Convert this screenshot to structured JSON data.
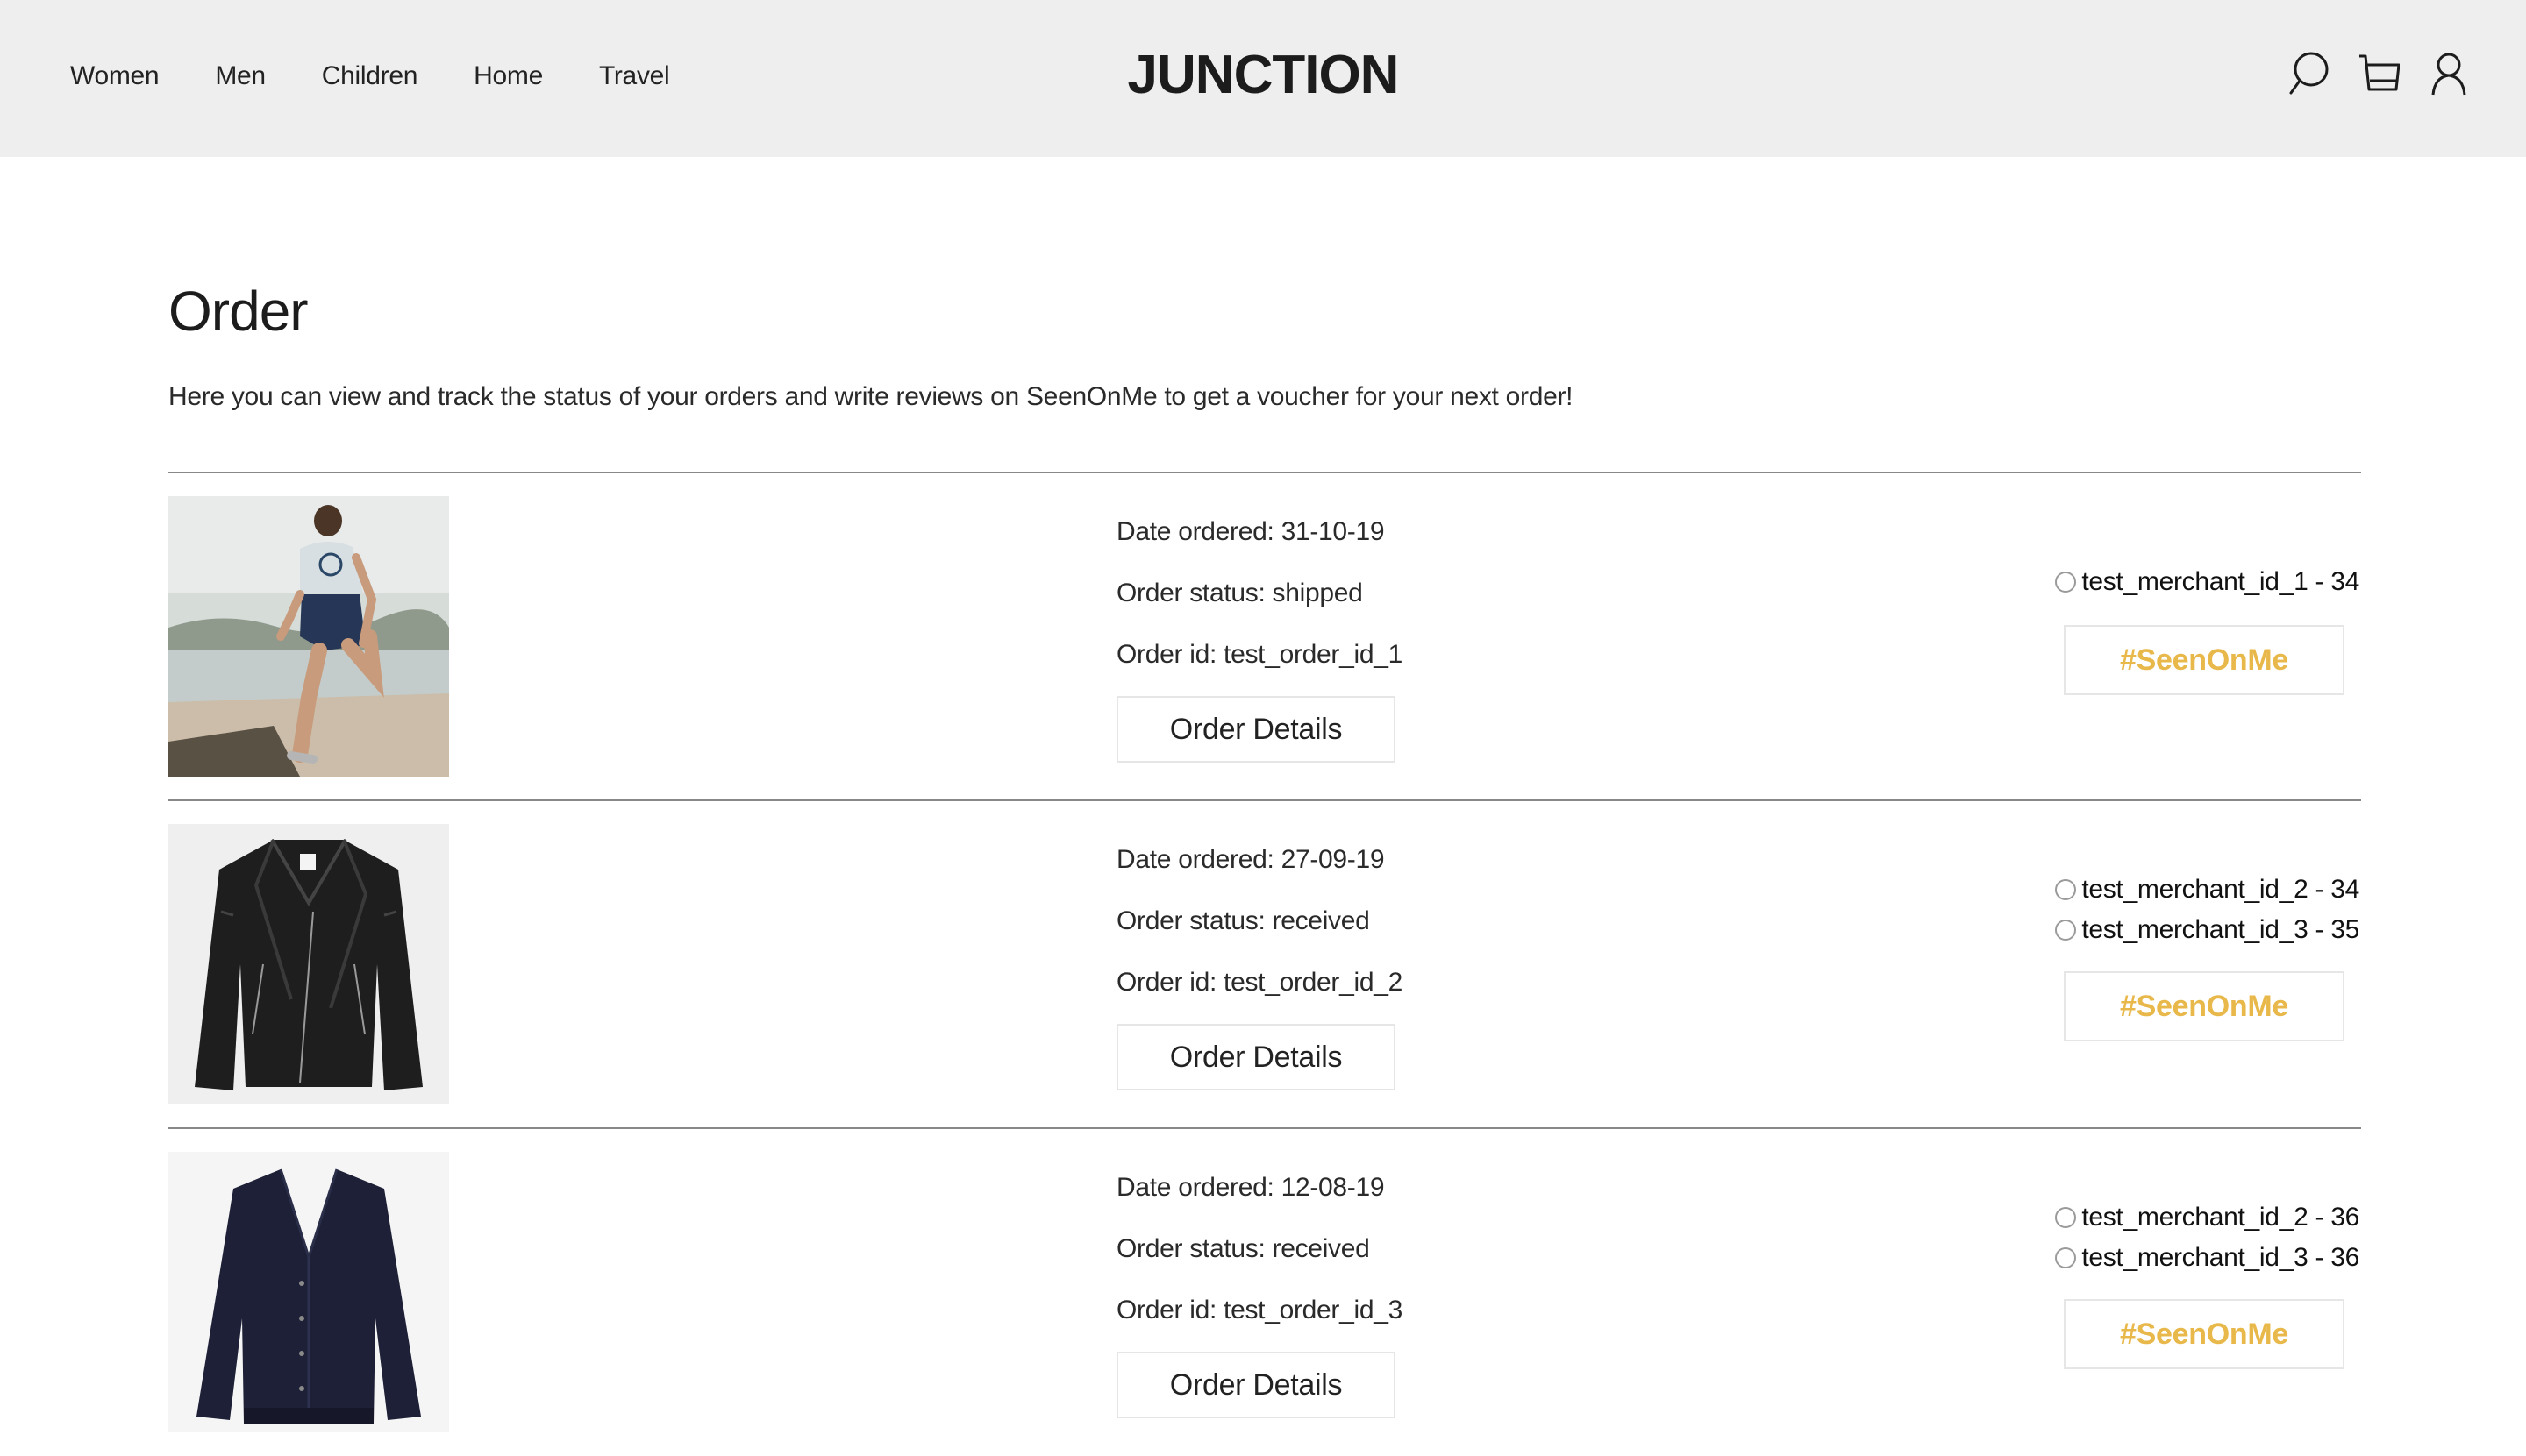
{
  "header": {
    "brand": "JUNCTION",
    "nav": [
      "Women",
      "Men",
      "Children",
      "Home",
      "Travel"
    ],
    "icons": [
      "search-icon",
      "cart-icon",
      "account-icon"
    ],
    "background": "#eeeeee"
  },
  "page": {
    "title": "Order",
    "intro": "Here you can view and track the status of your orders and write reviews on SeenOnMe to get a voucher for your next order!"
  },
  "orders": [
    {
      "image": "woman-stretching-photo",
      "date": "Date ordered: 31-10-19",
      "status": "Order status: shipped",
      "order_id": "Order id: test_order_id_1",
      "details_label": "Order Details",
      "merchants": [
        "test_merchant_id_1 - 34"
      ],
      "seen_label": "#SeenOnMe"
    },
    {
      "image": "leather-jacket-photo",
      "date": "Date ordered: 27-09-19",
      "status": "Order status: received",
      "order_id": "Order id: test_order_id_2",
      "details_label": "Order Details",
      "merchants": [
        "test_merchant_id_2 - 34",
        "test_merchant_id_3 - 35"
      ],
      "seen_label": "#SeenOnMe"
    },
    {
      "image": "navy-cardigan-photo",
      "date": "Date ordered: 12-08-19",
      "status": "Order status: received",
      "order_id": "Order id: test_order_id_3",
      "details_label": "Order Details",
      "merchants": [
        "test_merchant_id_2 - 36",
        "test_merchant_id_3 - 36"
      ],
      "seen_label": "#SeenOnMe"
    }
  ],
  "colors": {
    "accent": "#e8b84a",
    "divider": "#888888",
    "button_border": "#e6e6e6"
  }
}
